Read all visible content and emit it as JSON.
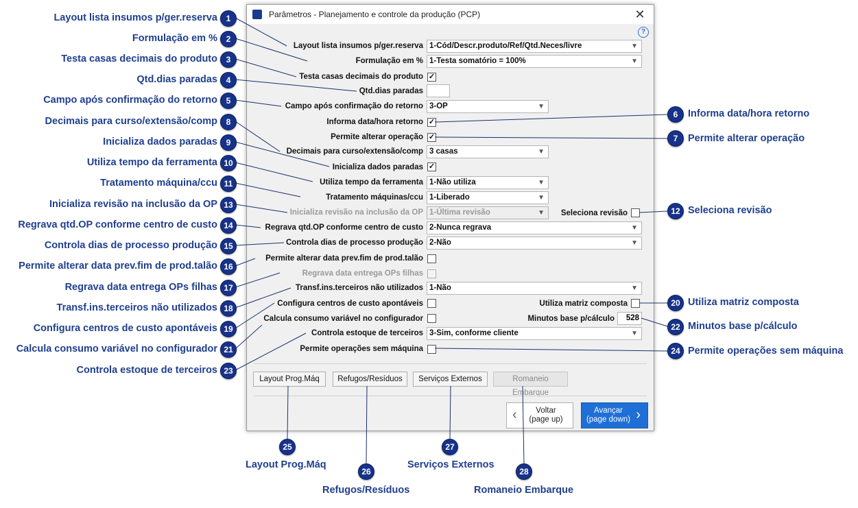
{
  "window": {
    "title": "Parâmetros - Planejamento e controle da produção (PCP)",
    "close_glyph": "✕",
    "help_glyph": "?"
  },
  "form": {
    "layout_lista_label": "Layout lista insumos p/ger.reserva",
    "layout_lista_value": "1-Cód/Descr.produto/Ref/Qtd.Neces/livre",
    "formulacao_label": "Formulação em %",
    "formulacao_value": "1-Testa somatório = 100%",
    "testa_casas_label": "Testa casas decimais do produto",
    "testa_casas_checked": "✓",
    "qtd_dias_label": "Qtd.dias paradas",
    "qtd_dias_value": "",
    "campo_apos_label": "Campo após confirmação do retorno",
    "campo_apos_value": "3-OP",
    "informa_data_label": "Informa data/hora retorno",
    "informa_data_checked": "✓",
    "permite_alterar_op_label": "Permite alterar operação",
    "permite_alterar_op_checked": "✓",
    "decimais_label": "Decimais para curso/extensão/comp",
    "decimais_value": "3 casas",
    "inicializa_dados_label": "Inicializa dados paradas",
    "inicializa_dados_checked": "✓",
    "utiliza_tempo_label": "Utiliza tempo da ferramenta",
    "utiliza_tempo_value": "1-Não utiliza",
    "tratamento_label": "Tratamento máquinas/ccu",
    "tratamento_value": "1-Liberado",
    "inicializa_revisao_label": "Inicializa revisão na inclusão da OP",
    "inicializa_revisao_value": "1-Última revisão",
    "seleciona_revisao_label": "Seleciona revisão",
    "regrava_qtd_label": "Regrava qtd.OP conforme centro de custo",
    "regrava_qtd_value": "2-Nunca regrava",
    "controla_dias_label": "Controla dias de processo produção",
    "controla_dias_value": "2-Não",
    "permite_alterar_data_label": "Permite alterar data prev.fim de prod.talão",
    "regrava_data_label": "Regrava data entrega OPs filhas",
    "transf_label": "Transf.ins.terceiros não utilizados",
    "transf_value": "1-Não",
    "configura_centros_label": "Configura centros de custo apontáveis",
    "utiliza_matriz_label": "Utiliza matriz composta",
    "calcula_consumo_label": "Calcula consumo variável no configurador",
    "minutos_base_label": "Minutos base p/cálculo",
    "minutos_base_value": "528",
    "controla_estoque_label": "Controla estoque de terceiros",
    "controla_estoque_value": "3-Sim, conforme cliente",
    "permite_operacoes_label": "Permite operações sem máquina"
  },
  "buttons": {
    "layout_prog": "Layout Prog.Máq",
    "refugos": "Refugos/Resíduos",
    "servicos": "Serviços Externos",
    "romaneio": "Romaneio Embarque",
    "voltar_line1": "Voltar",
    "voltar_line2": "(page up)",
    "avancar_line1": "Avançar",
    "avancar_line2": "(page down)"
  },
  "annotations": [
    {
      "n": "1",
      "text": "Layout lista insumos p/ger.reserva"
    },
    {
      "n": "2",
      "text": "Formulação em %"
    },
    {
      "n": "3",
      "text": "Testa casas decimais do produto"
    },
    {
      "n": "4",
      "text": "Qtd.dias paradas"
    },
    {
      "n": "5",
      "text": "Campo após confirmação do retorno"
    },
    {
      "n": "8",
      "text": "Decimais para curso/extensão/comp"
    },
    {
      "n": "9",
      "text": "Inicializa dados paradas"
    },
    {
      "n": "10",
      "text": "Utiliza tempo da ferramenta"
    },
    {
      "n": "11",
      "text": "Tratamento máquina/ccu"
    },
    {
      "n": "13",
      "text": "Inicializa revisão na inclusão da OP"
    },
    {
      "n": "14",
      "text": "Regrava qtd.OP conforme centro de custo"
    },
    {
      "n": "15",
      "text": "Controla dias de processo produção"
    },
    {
      "n": "16",
      "text": "Permite alterar data prev.fim de prod.talão"
    },
    {
      "n": "17",
      "text": "Regrava data entrega OPs filhas"
    },
    {
      "n": "18",
      "text": "Transf.ins.terceiros não utilizados"
    },
    {
      "n": "19",
      "text": "Configura centros de custo apontáveis"
    },
    {
      "n": "21",
      "text": "Calcula consumo variável no configurador"
    },
    {
      "n": "23",
      "text": "Controla estoque de terceiros"
    },
    {
      "n": "6",
      "text": "Informa data/hora retorno"
    },
    {
      "n": "7",
      "text": "Permite alterar operação"
    },
    {
      "n": "12",
      "text": "Seleciona revisão"
    },
    {
      "n": "20",
      "text": "Utiliza matriz composta"
    },
    {
      "n": "22",
      "text": "Minutos base p/cálculo"
    },
    {
      "n": "24",
      "text": "Permite operações sem máquina"
    },
    {
      "n": "25",
      "text": "Layout Prog.Máq"
    },
    {
      "n": "26",
      "text": "Refugos/Resíduos"
    },
    {
      "n": "27",
      "text": "Serviços Externos"
    },
    {
      "n": "28",
      "text": "Romaneio Embarque"
    }
  ],
  "colors": {
    "annotation_text": "#1f3f8f",
    "badge_fill": "#17328a",
    "primary_button": "#1f6fd6",
    "leader_line": "#1b2f6b"
  },
  "icons": {
    "app": "app-icon",
    "checkmark": "check-icon",
    "dropdown": "chevron-down-icon",
    "back": "chevron-left-icon",
    "next": "chevron-right-icon",
    "help": "help-icon",
    "close": "close-icon"
  }
}
